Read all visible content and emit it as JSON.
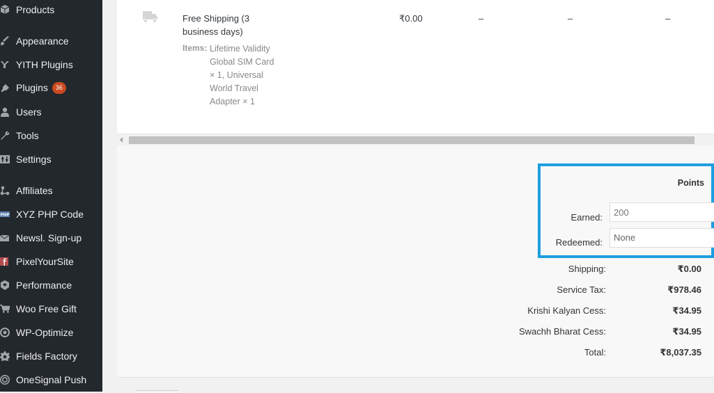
{
  "sidebar": {
    "items": [
      {
        "label": "Products",
        "icon": "box-icon"
      },
      {
        "label": "Appearance",
        "icon": "paintbrush-icon"
      },
      {
        "label": "YITH Plugins",
        "icon": "yith-icon"
      },
      {
        "label": "Plugins",
        "icon": "plug-icon",
        "badge": "36"
      },
      {
        "label": "Users",
        "icon": "user-icon"
      },
      {
        "label": "Tools",
        "icon": "wrench-icon"
      },
      {
        "label": "Settings",
        "icon": "settings-sliders-icon"
      },
      {
        "label": "Affiliates",
        "icon": "affiliates-icon"
      },
      {
        "label": "XYZ PHP Code",
        "icon": "php-icon"
      },
      {
        "label": "Newsl. Sign-up",
        "icon": "envelope-icon"
      },
      {
        "label": "PixelYourSite",
        "icon": "facebook-icon"
      },
      {
        "label": "Performance",
        "icon": "performance-icon"
      },
      {
        "label": "Woo Free Gift",
        "icon": "cart-icon"
      },
      {
        "label": "WP-Optimize",
        "icon": "optimize-icon"
      },
      {
        "label": "Fields Factory",
        "icon": "gear-icon"
      },
      {
        "label": "OneSignal Push",
        "icon": "onesignal-icon"
      }
    ]
  },
  "shipping_line": {
    "name": "Free Shipping (3 business days)",
    "items_label": "Items:",
    "items_value": "Lifetime Validity Global SIM Card × 1, Universal World Travel Adapter × 1",
    "cost": "₹0.00",
    "dash1": "–",
    "dash2": "–",
    "dash3": "–"
  },
  "points": {
    "title": "Points",
    "earned_label": "Earned:",
    "earned_placeholder": "200",
    "redeemed_label": "Redeemed:",
    "redeemed_value": "None"
  },
  "totals": [
    {
      "label": "Shipping:",
      "value": "₹0.00"
    },
    {
      "label": "Service Tax:",
      "value": "₹978.46"
    },
    {
      "label": "Krishi Kalyan Cess:",
      "value": "₹34.95"
    },
    {
      "label": "Swachh Bharat Cess:",
      "value": "₹34.95"
    },
    {
      "label": "Total:",
      "value": "₹8,037.35"
    }
  ],
  "colors": {
    "sidebar_bg": "#23282d",
    "badge": "#ca4a1f",
    "highlight_border": "#1e9ee0"
  }
}
